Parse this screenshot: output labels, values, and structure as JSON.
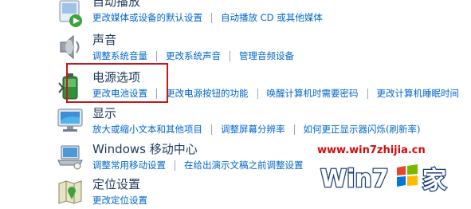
{
  "categories": [
    {
      "title": "自动播放",
      "links": [
        "更改媒体或设备的默认设置",
        "自动播放 CD 或其他媒体"
      ]
    },
    {
      "title": "声音",
      "links": [
        "调整系统音量",
        "更改系统声音",
        "管理音频设备"
      ]
    },
    {
      "title": "电源选项",
      "links": [
        "更改电池设置",
        "更改电源按钮的功能",
        "唤醒计算机时需要密码",
        "更改计算机睡眠时间"
      ]
    },
    {
      "title": "显示",
      "links": [
        "放大或缩小文本和其他项目",
        "调整屏幕分辨率",
        "如何更正显示器闪烁(刷新率)"
      ]
    },
    {
      "title": "Windows 移动中心",
      "links": [
        "调整常用移动设置",
        "在给出演示文稿之前调整设置"
      ]
    },
    {
      "title": "定位设置",
      "links": [
        "更改定位设置"
      ]
    }
  ],
  "watermark": {
    "url": "www.win7zhijia.cn",
    "logo_text": "Win7",
    "logo_suffix": "家"
  },
  "colors": {
    "title": "#1e395b",
    "link": "#0066cc",
    "highlight_border": "#c21a1a",
    "watermark": "#d10a0a"
  }
}
